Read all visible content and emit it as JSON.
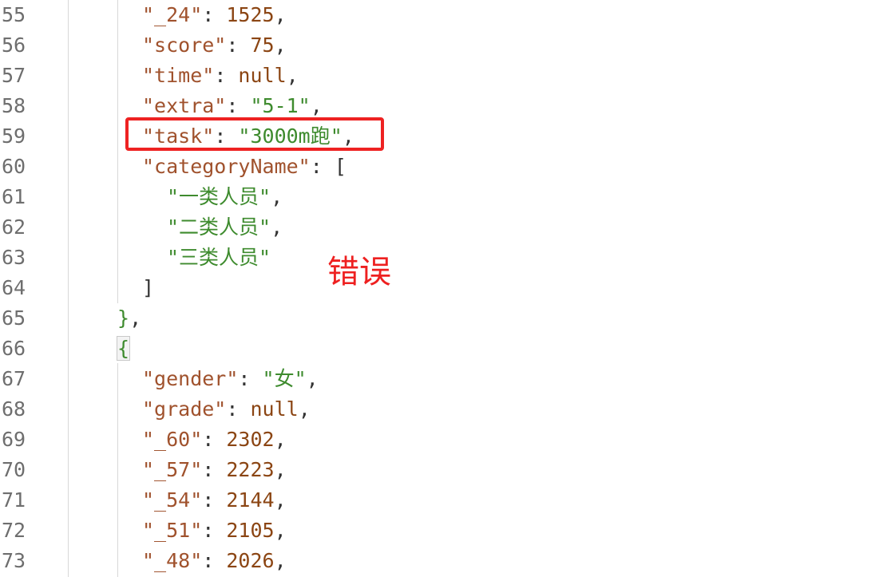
{
  "lines": [
    {
      "num": "55",
      "parts": [
        {
          "t": "\"_24\"",
          "c": "k"
        },
        {
          "t": ": ",
          "c": "p"
        },
        {
          "t": "1525",
          "c": "n"
        },
        {
          "t": ",",
          "c": "p"
        }
      ]
    },
    {
      "num": "56",
      "parts": [
        {
          "t": "\"score\"",
          "c": "k"
        },
        {
          "t": ": ",
          "c": "p"
        },
        {
          "t": "75",
          "c": "n"
        },
        {
          "t": ",",
          "c": "p"
        }
      ]
    },
    {
      "num": "57",
      "parts": [
        {
          "t": "\"time\"",
          "c": "k"
        },
        {
          "t": ": ",
          "c": "p"
        },
        {
          "t": "null",
          "c": "nl"
        },
        {
          "t": ",",
          "c": "p"
        }
      ]
    },
    {
      "num": "58",
      "parts": [
        {
          "t": "\"extra\"",
          "c": "k"
        },
        {
          "t": ": ",
          "c": "p"
        },
        {
          "t": "\"5-1\"",
          "c": "s"
        },
        {
          "t": ",",
          "c": "p"
        }
      ]
    },
    {
      "num": "59",
      "parts": [
        {
          "t": "\"task\"",
          "c": "k"
        },
        {
          "t": ": ",
          "c": "p"
        },
        {
          "t": "\"3000m跑\"",
          "c": "s"
        },
        {
          "t": ",",
          "c": "p"
        }
      ]
    },
    {
      "num": "60",
      "parts": [
        {
          "t": "\"categoryName\"",
          "c": "k"
        },
        {
          "t": ": [",
          "c": "p"
        }
      ]
    },
    {
      "num": "61",
      "parts": [
        {
          "t": "\"一类人员\"",
          "c": "s"
        },
        {
          "t": ",",
          "c": "p"
        }
      ]
    },
    {
      "num": "62",
      "parts": [
        {
          "t": "\"二类人员\"",
          "c": "s"
        },
        {
          "t": ",",
          "c": "p"
        }
      ]
    },
    {
      "num": "63",
      "parts": [
        {
          "t": "\"三类人员\"",
          "c": "s"
        }
      ]
    },
    {
      "num": "64",
      "parts": [
        {
          "t": "]",
          "c": "p"
        }
      ]
    },
    {
      "num": "65",
      "parts": [
        {
          "t": "}",
          "c": "brace"
        },
        {
          "t": ",",
          "c": "p"
        }
      ]
    },
    {
      "num": "66",
      "parts": [
        {
          "t": "{",
          "c": "brace"
        }
      ]
    },
    {
      "num": "67",
      "parts": [
        {
          "t": "\"gender\"",
          "c": "k"
        },
        {
          "t": ": ",
          "c": "p"
        },
        {
          "t": "\"女\"",
          "c": "s"
        },
        {
          "t": ",",
          "c": "p"
        }
      ]
    },
    {
      "num": "68",
      "parts": [
        {
          "t": "\"grade\"",
          "c": "k"
        },
        {
          "t": ": ",
          "c": "p"
        },
        {
          "t": "null",
          "c": "nl"
        },
        {
          "t": ",",
          "c": "p"
        }
      ]
    },
    {
      "num": "69",
      "parts": [
        {
          "t": "\"_60\"",
          "c": "k"
        },
        {
          "t": ": ",
          "c": "p"
        },
        {
          "t": "2302",
          "c": "n"
        },
        {
          "t": ",",
          "c": "p"
        }
      ]
    },
    {
      "num": "70",
      "parts": [
        {
          "t": "\"_57\"",
          "c": "k"
        },
        {
          "t": ": ",
          "c": "p"
        },
        {
          "t": "2223",
          "c": "n"
        },
        {
          "t": ",",
          "c": "p"
        }
      ]
    },
    {
      "num": "71",
      "parts": [
        {
          "t": "\"_54\"",
          "c": "k"
        },
        {
          "t": ": ",
          "c": "p"
        },
        {
          "t": "2144",
          "c": "n"
        },
        {
          "t": ",",
          "c": "p"
        }
      ]
    },
    {
      "num": "72",
      "parts": [
        {
          "t": "\"_51\"",
          "c": "k"
        },
        {
          "t": ": ",
          "c": "p"
        },
        {
          "t": "2105",
          "c": "n"
        },
        {
          "t": ",",
          "c": "p"
        }
      ]
    },
    {
      "num": "73",
      "parts": [
        {
          "t": "\"_48\"",
          "c": "k"
        },
        {
          "t": ": ",
          "c": "p"
        },
        {
          "t": "2026",
          "c": "n"
        },
        {
          "t": ",",
          "c": "p"
        }
      ]
    }
  ],
  "annotation": {
    "label": "错误",
    "color": "#ee2020"
  }
}
